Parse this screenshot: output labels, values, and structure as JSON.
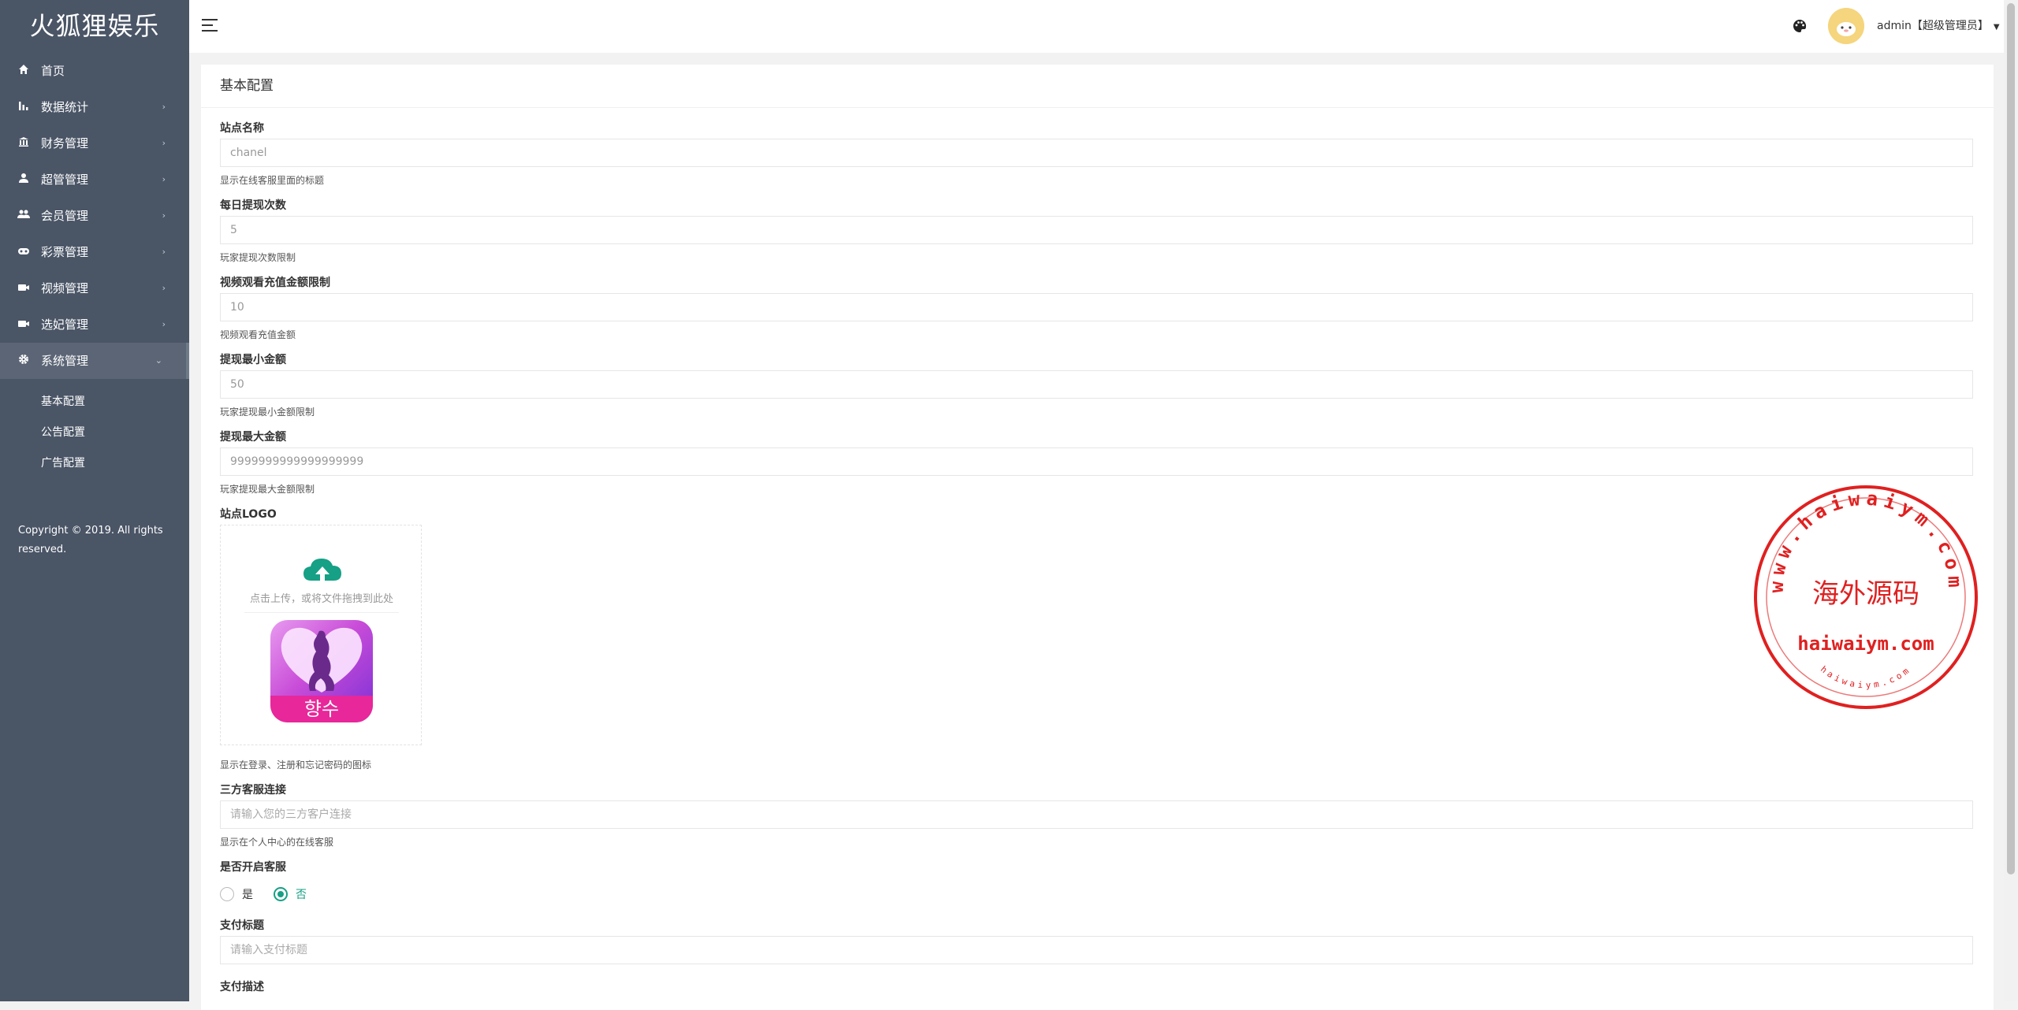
{
  "brand": "火狐狸娱乐",
  "sidebar": {
    "items": [
      {
        "label": "首页",
        "icon": "home-icon",
        "has_caret": false
      },
      {
        "label": "数据统计",
        "icon": "bar-chart-icon",
        "has_caret": true
      },
      {
        "label": "财务管理",
        "icon": "bank-icon",
        "has_caret": true
      },
      {
        "label": "超管管理",
        "icon": "user-icon",
        "has_caret": true
      },
      {
        "label": "会员管理",
        "icon": "users-icon",
        "has_caret": true
      },
      {
        "label": "彩票管理",
        "icon": "gamepad-icon",
        "has_caret": true
      },
      {
        "label": "视频管理",
        "icon": "video-icon",
        "has_caret": true
      },
      {
        "label": "选妃管理",
        "icon": "video-icon",
        "has_caret": true
      },
      {
        "label": "系统管理",
        "icon": "gear-icon",
        "has_caret": true,
        "expanded": true
      }
    ],
    "subitems": [
      "基本配置",
      "公告配置",
      "广告配置"
    ],
    "copyright": "Copyright © 2019. All rights reserved."
  },
  "header": {
    "user": "admin【超级管理员】"
  },
  "page": {
    "title": "基本配置",
    "fields": [
      {
        "label": "站点名称",
        "value": "chanel",
        "help": "显示在线客服里面的标题"
      },
      {
        "label": "每日提现次数",
        "value": "5",
        "help": "玩家提现次数限制"
      },
      {
        "label": "视频观看充值金额限制",
        "value": "10",
        "help": "视频观看充值金额"
      },
      {
        "label": "提现最小金额",
        "value": "50",
        "help": "玩家提现最小金额限制"
      },
      {
        "label": "提现最大金额",
        "value": "9999999999999999999",
        "help": "玩家提现最大金额限制"
      }
    ],
    "logo": {
      "label": "站点LOGO",
      "upload_text": "点击上传，或将文件拖拽到此处",
      "image_text": "향수",
      "help": "显示在登录、注册和忘记密码的图标"
    },
    "third_party": {
      "label": "三方客服连接",
      "placeholder": "请输入您的三方客户连接",
      "help": "显示在个人中心的在线客服"
    },
    "service_toggle": {
      "label": "是否开启客服",
      "options": [
        "是",
        "否"
      ],
      "selected": "否"
    },
    "pay_title": {
      "label": "支付标题",
      "placeholder": "请输入支付标题"
    },
    "pay_desc": {
      "label": "支付描述"
    }
  },
  "watermark": {
    "ring_text": "www.haiwaiym.com",
    "center_text": "海外源码",
    "domain_text": "haiwaiym.com",
    "bottom_text": "haiwaiym.com"
  },
  "colors": {
    "sidebar_bg": "#4a5566",
    "accent": "#16a085",
    "stamp_red": "#e02020"
  }
}
